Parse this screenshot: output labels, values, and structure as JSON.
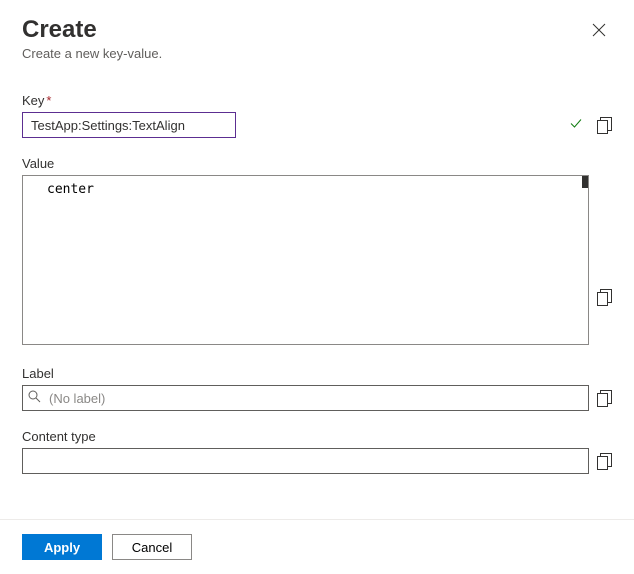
{
  "header": {
    "title": "Create",
    "subtitle": "Create a new key-value."
  },
  "fields": {
    "key": {
      "label": "Key",
      "required_marker": "*",
      "value": "TestApp:Settings:TextAlign"
    },
    "value": {
      "label": "Value",
      "value": "center"
    },
    "labelField": {
      "label": "Label",
      "placeholder": "(No label)",
      "value": ""
    },
    "contentType": {
      "label": "Content type",
      "value": ""
    }
  },
  "footer": {
    "apply": "Apply",
    "cancel": "Cancel"
  }
}
